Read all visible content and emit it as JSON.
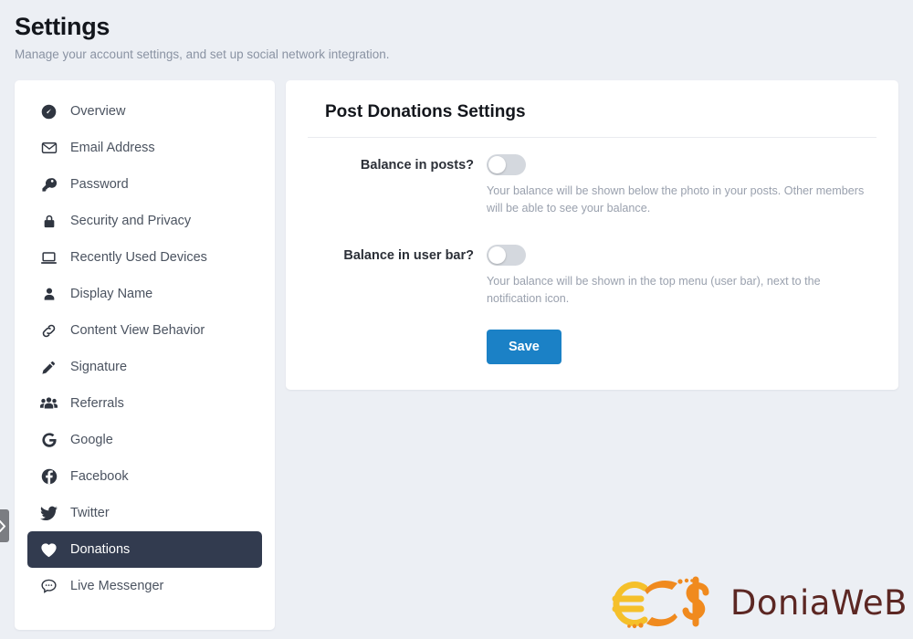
{
  "header": {
    "title": "Settings",
    "subtitle": "Manage your account settings, and set up social network integration."
  },
  "sidebar": {
    "items": [
      {
        "label": "Overview",
        "icon": "gauge-icon",
        "active": false
      },
      {
        "label": "Email Address",
        "icon": "envelope-icon",
        "active": false
      },
      {
        "label": "Password",
        "icon": "key-icon",
        "active": false
      },
      {
        "label": "Security and Privacy",
        "icon": "lock-icon",
        "active": false
      },
      {
        "label": "Recently Used Devices",
        "icon": "laptop-icon",
        "active": false
      },
      {
        "label": "Display Name",
        "icon": "user-icon",
        "active": false
      },
      {
        "label": "Content View Behavior",
        "icon": "link-icon",
        "active": false
      },
      {
        "label": "Signature",
        "icon": "pencil-icon",
        "active": false
      },
      {
        "label": "Referrals",
        "icon": "users-icon",
        "active": false
      },
      {
        "label": "Google",
        "icon": "google-icon",
        "active": false
      },
      {
        "label": "Facebook",
        "icon": "facebook-icon",
        "active": false
      },
      {
        "label": "Twitter",
        "icon": "twitter-icon",
        "active": false
      },
      {
        "label": "Donations",
        "icon": "heart-icon",
        "active": true
      },
      {
        "label": "Live Messenger",
        "icon": "chat-bubble-icon",
        "active": false
      }
    ]
  },
  "main": {
    "panel_title": "Post Donations Settings",
    "fields": [
      {
        "label": "Balance in posts?",
        "toggle_state": "off",
        "help": "Your balance will be shown below the photo in your posts. Other members will be able to see your balance."
      },
      {
        "label": "Balance in user bar?",
        "toggle_state": "off",
        "help": "Your balance will be shown in the top menu (user bar), next to the notification icon."
      }
    ],
    "save_label": "Save"
  },
  "edge_handle": {
    "icon": "chevron-right-icon"
  },
  "watermark": {
    "text": "DoniaWeB",
    "euro_symbol": "€",
    "dollar_symbol": "$"
  },
  "colors": {
    "page_bg": "#eceff4",
    "panel_bg": "#ffffff",
    "active_nav_bg": "#323b4f",
    "save_button": "#1b81c6",
    "toggle_track_off": "#d4d8de",
    "help_text": "#9aa1ae",
    "logo_text": "#5c2723",
    "logo_euro": "#f5c02a",
    "logo_dollar": "#f08a1e"
  }
}
